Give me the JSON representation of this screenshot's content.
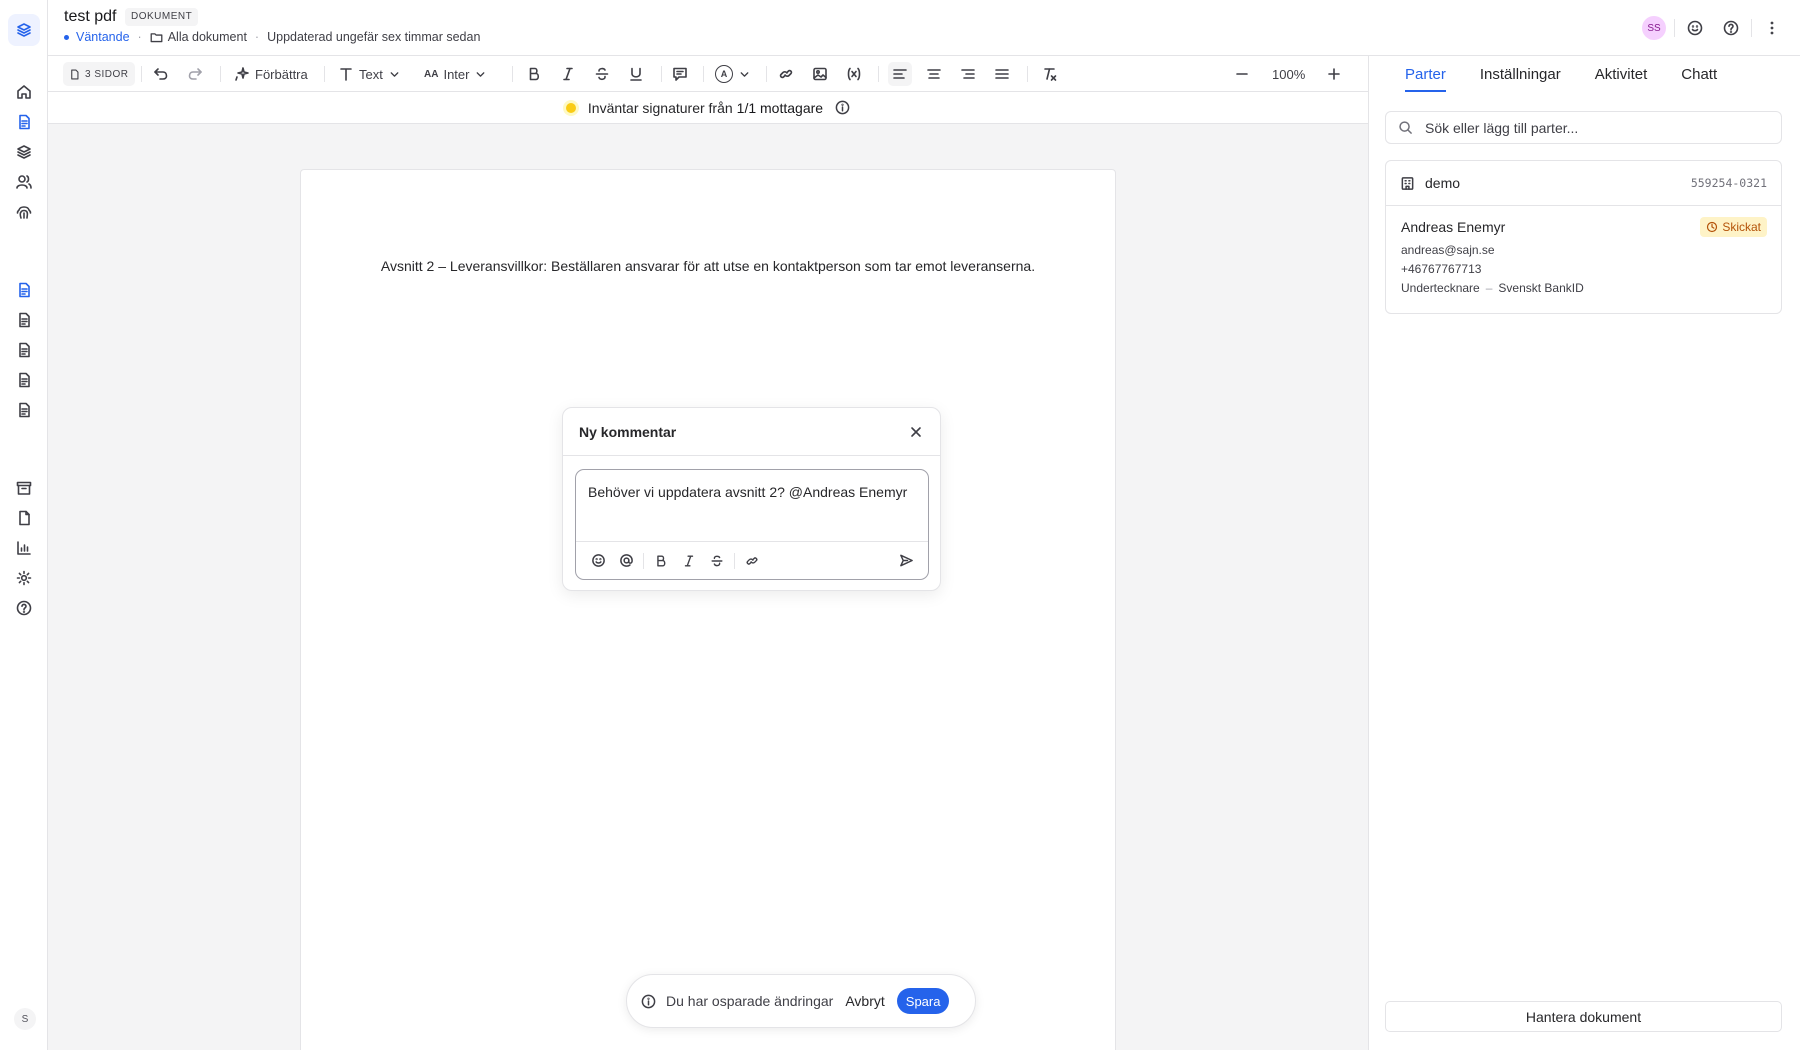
{
  "header": {
    "title": "test pdf",
    "doc_badge": "DOKUMENT",
    "status": "Väntande",
    "folder": "Alla dokument",
    "updated": "Uppdaterad ungefär sex timmar sedan",
    "user_initials": "SS"
  },
  "toolbar": {
    "pages": "3 SIDOR",
    "improve": "Förbättra",
    "text_style": "Text",
    "font": "Inter",
    "zoom": "100%"
  },
  "status_bar": {
    "message": "Inväntar signaturer från",
    "count": "1/1 mottagare"
  },
  "document": {
    "paragraph": "Avsnitt 2 – Leveransvillkor: Beställaren ansvarar för att utse en kontaktperson som tar emot leveranserna."
  },
  "comment": {
    "title": "Ny kommentar",
    "text": "Behöver vi uppdatera avsnitt 2? @Andreas Enemyr"
  },
  "unsaved": {
    "message": "Du har osparade ändringar",
    "cancel": "Avbryt",
    "save": "Spara"
  },
  "panel": {
    "tabs": [
      {
        "label": "Parter",
        "active": true
      },
      {
        "label": "Inställningar"
      },
      {
        "label": "Aktivitet"
      },
      {
        "label": "Chatt"
      }
    ],
    "search_placeholder": "Sök eller lägg till parter...",
    "org": {
      "name": "demo",
      "number": "559254-0321"
    },
    "party": {
      "name": "Andreas Enemyr",
      "status": "Skickat",
      "email": "andreas@sajn.se",
      "phone": "+46767767713",
      "role": "Undertecknare",
      "method": "Svenskt BankID"
    },
    "manage": "Hantera dokument"
  },
  "rail": {
    "user_initial": "S"
  },
  "colors": {
    "accent": "#2563eb",
    "pending": "#facc15",
    "sent": "#b45309"
  }
}
